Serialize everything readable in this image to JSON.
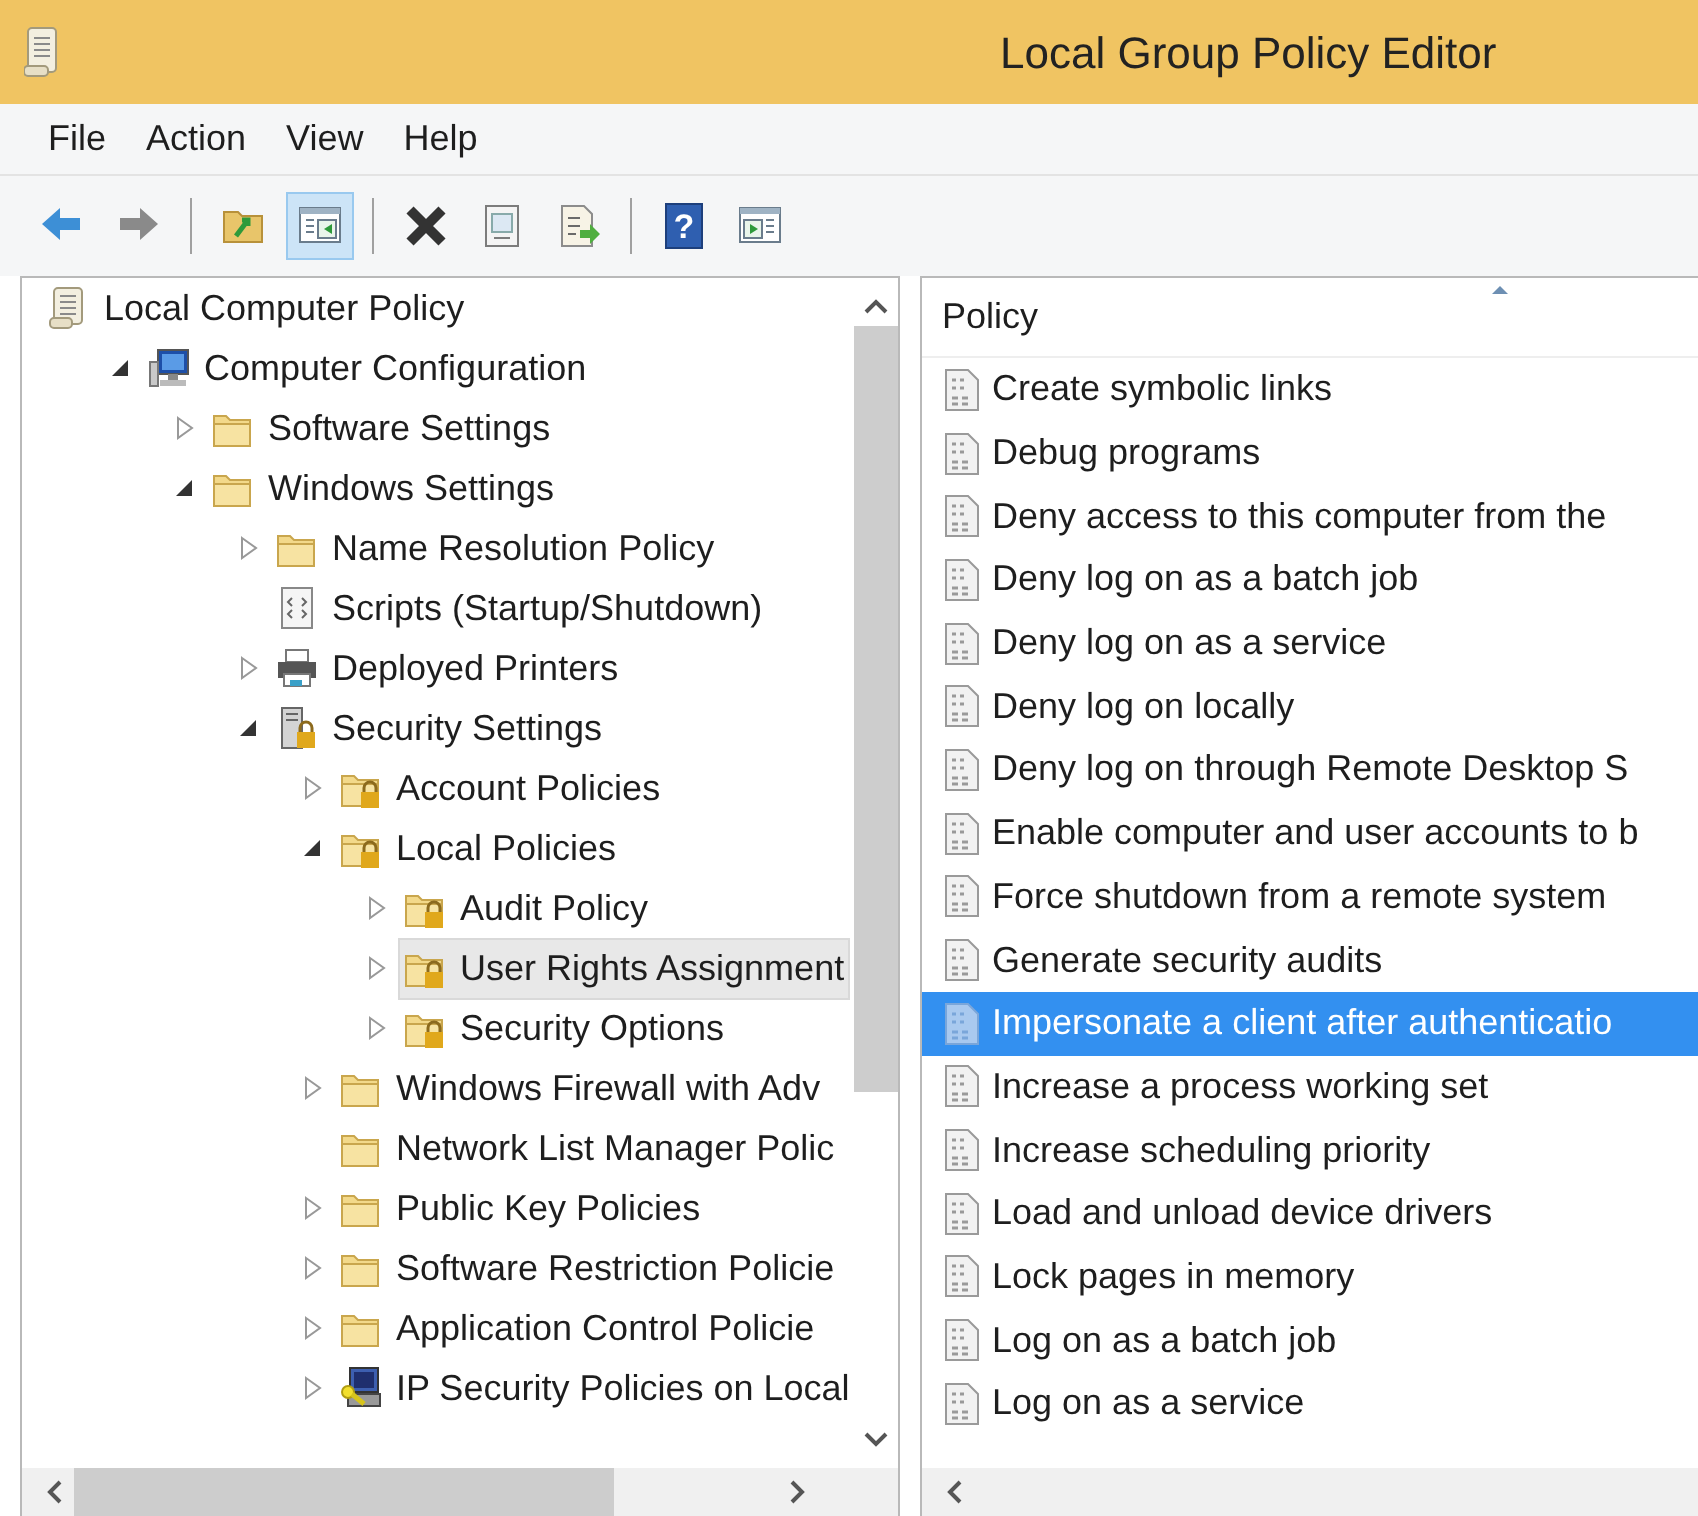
{
  "window": {
    "title": "Local Group Policy Editor"
  },
  "menu": [
    "File",
    "Action",
    "View",
    "Help"
  ],
  "toolbar": [
    {
      "kind": "back",
      "pressed": false
    },
    {
      "kind": "forward",
      "pressed": false
    },
    {
      "kind": "separator"
    },
    {
      "kind": "up",
      "pressed": false
    },
    {
      "kind": "tree-pane",
      "pressed": true
    },
    {
      "kind": "separator"
    },
    {
      "kind": "delete",
      "pressed": false
    },
    {
      "kind": "properties",
      "pressed": false
    },
    {
      "kind": "export",
      "pressed": false
    },
    {
      "kind": "separator"
    },
    {
      "kind": "help",
      "pressed": false,
      "glyph": "?"
    },
    {
      "kind": "action-pane",
      "pressed": false
    }
  ],
  "tree": [
    {
      "label": "Local Computer Policy",
      "kind": "policy",
      "selected": false,
      "children": [
        {
          "label": "Computer Configuration",
          "kind": "computer",
          "expanded": true,
          "selected": false,
          "children": [
            {
              "label": "Software Settings",
              "kind": "folder",
              "expanded": false,
              "selected": false
            },
            {
              "label": "Windows Settings",
              "kind": "folder",
              "expanded": true,
              "selected": false,
              "children": [
                {
                  "label": "Name Resolution Policy",
                  "kind": "folder",
                  "expanded": false,
                  "selected": false
                },
                {
                  "label": "Scripts (Startup/Shutdown)",
                  "kind": "script",
                  "selected": false
                },
                {
                  "label": "Deployed Printers",
                  "kind": "printer",
                  "expanded": false,
                  "selected": false
                },
                {
                  "label": "Security Settings",
                  "kind": "security",
                  "expanded": true,
                  "selected": false,
                  "children": [
                    {
                      "label": "Account Policies",
                      "kind": "locked-folder",
                      "expanded": false,
                      "selected": false
                    },
                    {
                      "label": "Local Policies",
                      "kind": "locked-folder",
                      "expanded": true,
                      "selected": false,
                      "children": [
                        {
                          "label": "Audit Policy",
                          "kind": "locked-folder",
                          "expanded": false,
                          "selected": false
                        },
                        {
                          "label": "User Rights Assignment",
                          "kind": "locked-folder",
                          "expanded": false,
                          "selected": true
                        },
                        {
                          "label": "Security Options",
                          "kind": "locked-folder",
                          "expanded": false,
                          "selected": false
                        }
                      ]
                    },
                    {
                      "label": "Windows Firewall with Adv",
                      "kind": "folder",
                      "expanded": false,
                      "selected": false
                    },
                    {
                      "label": "Network List Manager Polic",
                      "kind": "folder",
                      "selected": false
                    },
                    {
                      "label": "Public Key Policies",
                      "kind": "folder",
                      "expanded": false,
                      "selected": false
                    },
                    {
                      "label": "Software Restriction Policie",
                      "kind": "folder",
                      "expanded": false,
                      "selected": false
                    },
                    {
                      "label": "Application Control Policie",
                      "kind": "folder",
                      "expanded": false,
                      "selected": false
                    },
                    {
                      "label": "IP Security Policies on Local",
                      "kind": "ipsec",
                      "expanded": false,
                      "selected": false
                    }
                  ]
                }
              ]
            }
          ]
        }
      ]
    }
  ],
  "list": {
    "columns": [
      {
        "label": "Policy",
        "sorted": true
      }
    ],
    "rows": [
      {
        "label": "Create symbolic links",
        "selected": false
      },
      {
        "label": "Debug programs",
        "selected": false
      },
      {
        "label": "Deny access to this computer from the",
        "selected": false
      },
      {
        "label": "Deny log on as a batch job",
        "selected": false
      },
      {
        "label": "Deny log on as a service",
        "selected": false
      },
      {
        "label": "Deny log on locally",
        "selected": false
      },
      {
        "label": "Deny log on through Remote Desktop S",
        "selected": false
      },
      {
        "label": "Enable computer and user accounts to b",
        "selected": false
      },
      {
        "label": "Force shutdown from a remote system",
        "selected": false
      },
      {
        "label": "Generate security audits",
        "selected": false
      },
      {
        "label": "Impersonate a client after authenticatio",
        "selected": true
      },
      {
        "label": "Increase a process working set",
        "selected": false
      },
      {
        "label": "Increase scheduling priority",
        "selected": false
      },
      {
        "label": "Load and unload device drivers",
        "selected": false
      },
      {
        "label": "Lock pages in memory",
        "selected": false
      },
      {
        "label": "Log on as a batch job",
        "selected": false
      },
      {
        "label": "Log on as a service",
        "selected": false
      }
    ]
  }
}
